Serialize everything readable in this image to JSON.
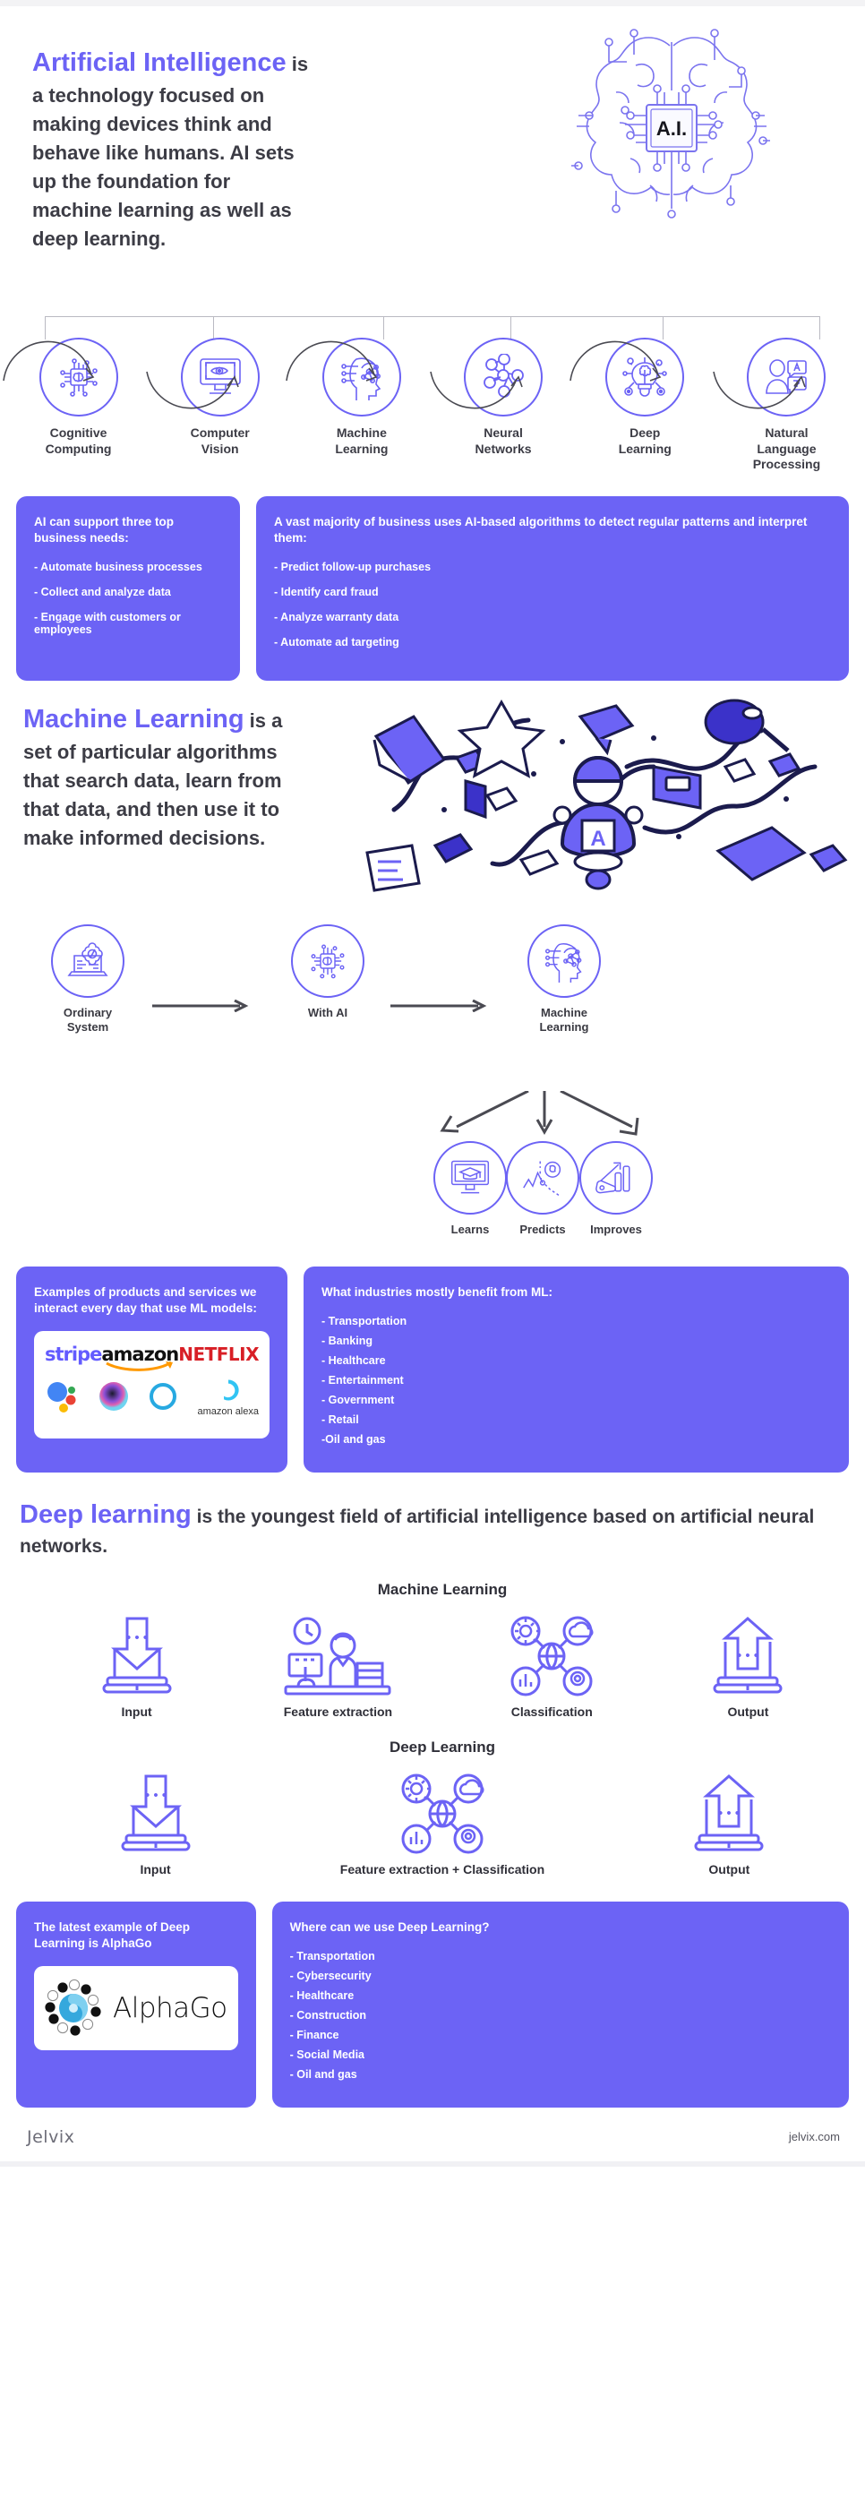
{
  "intro": {
    "heading": "Artificial Intelligence",
    "body": " is a technology focused on making devices think and behave like humans. AI sets up the foundation for machine learning as well as deep learning.",
    "brain_chip_label": "A.I."
  },
  "branches": [
    {
      "label": "Cognitive\nComputing",
      "icon": "cpu-brain-icon"
    },
    {
      "label": "Computer\nVision",
      "icon": "monitor-eye-icon"
    },
    {
      "label": "Machine\nLearning",
      "icon": "head-network-icon"
    },
    {
      "label": "Neural\nNetworks",
      "icon": "neural-network-icon"
    },
    {
      "label": "Deep\nLearning",
      "icon": "bulb-brain-icon"
    },
    {
      "label": "Natural\nLanguage\nProcessing",
      "icon": "person-translate-icon"
    }
  ],
  "ai_cards": [
    {
      "title": "AI can support three top business needs:",
      "items": [
        "- Automate business processes",
        "- Collect and analyze data",
        "- Engage with customers or employees"
      ]
    },
    {
      "title": "A vast majority of business uses AI-based algorithms to detect regular patterns and interpret them:",
      "items": [
        "- Predict follow-up purchases",
        "- Identify card fraud",
        "- Analyze warranty data",
        "- Automate ad targeting"
      ]
    }
  ],
  "ml": {
    "heading": "Machine Learning",
    "body": " is a set of particular algorithms that search data, learn from that data, and then use it to make informed decisions."
  },
  "ml_flow": [
    {
      "label": "Ordinary\nSystem",
      "icon": "laptop-gear-code-icon"
    },
    {
      "label": "With AI",
      "icon": "chip-brain-icon"
    },
    {
      "label": "Machine\nLearning",
      "icon": "head-network-icon"
    }
  ],
  "ml_outcomes": [
    {
      "label": "Learns",
      "icon": "monitor-graduation-cap-icon"
    },
    {
      "label": "Predicts",
      "icon": "chart-prediction-icon"
    },
    {
      "label": "Improves",
      "icon": "hand-growth-chart-icon"
    }
  ],
  "ml_cards": [
    {
      "title": "Examples of products and services we interact every day that use ML models:",
      "logos_row1": [
        "stripe",
        "amazon",
        "NETFLIX"
      ],
      "logos_row2": [
        "google-assistant-logo",
        "siri-logo",
        "cortana-logo",
        "amazon alexa"
      ]
    },
    {
      "title": "What industries mostly benefit from ML:",
      "items": [
        "- Transportation",
        "- Banking",
        "- Healthcare",
        "- Entertainment",
        "- Government",
        "- Retail",
        "-Oil and gas"
      ]
    }
  ],
  "dl": {
    "heading": "Deep learning",
    "body": " is the youngest field of artificial intelligence based on artificial neural networks."
  },
  "pipelines": [
    {
      "title": "Machine Learning",
      "steps": [
        {
          "label": "Input",
          "icon": "laptop-download-icon"
        },
        {
          "label": "Feature extraction",
          "icon": "person-workstation-icon"
        },
        {
          "label": "Classification",
          "icon": "globe-nodes-icon"
        },
        {
          "label": "Output",
          "icon": "laptop-upload-icon"
        }
      ]
    },
    {
      "title": "Deep Learning",
      "steps": [
        {
          "label": "Input",
          "icon": "laptop-download-icon"
        },
        {
          "label": "Feature extraction + Classification",
          "icon": "globe-nodes-icon"
        },
        {
          "label": "Output",
          "icon": "laptop-upload-icon"
        }
      ]
    }
  ],
  "dl_cards": [
    {
      "title": "The latest example of Deep Learning is AlphaGo",
      "logo_text": "AlphaGo"
    },
    {
      "title": "Where can we use Deep Learning?",
      "items": [
        "- Transportation",
        "- Cybersecurity",
        "- Healthcare",
        "- Construction",
        "- Finance",
        "- Social Media",
        "- Oil and gas"
      ]
    }
  ],
  "footer": {
    "logo": "Jelvix",
    "url": "jelvix.com"
  },
  "colors": {
    "accent": "#6c63f5",
    "text": "#3c3c45",
    "card_bg": "#6c63f5",
    "arrow": "#4a4a52"
  }
}
